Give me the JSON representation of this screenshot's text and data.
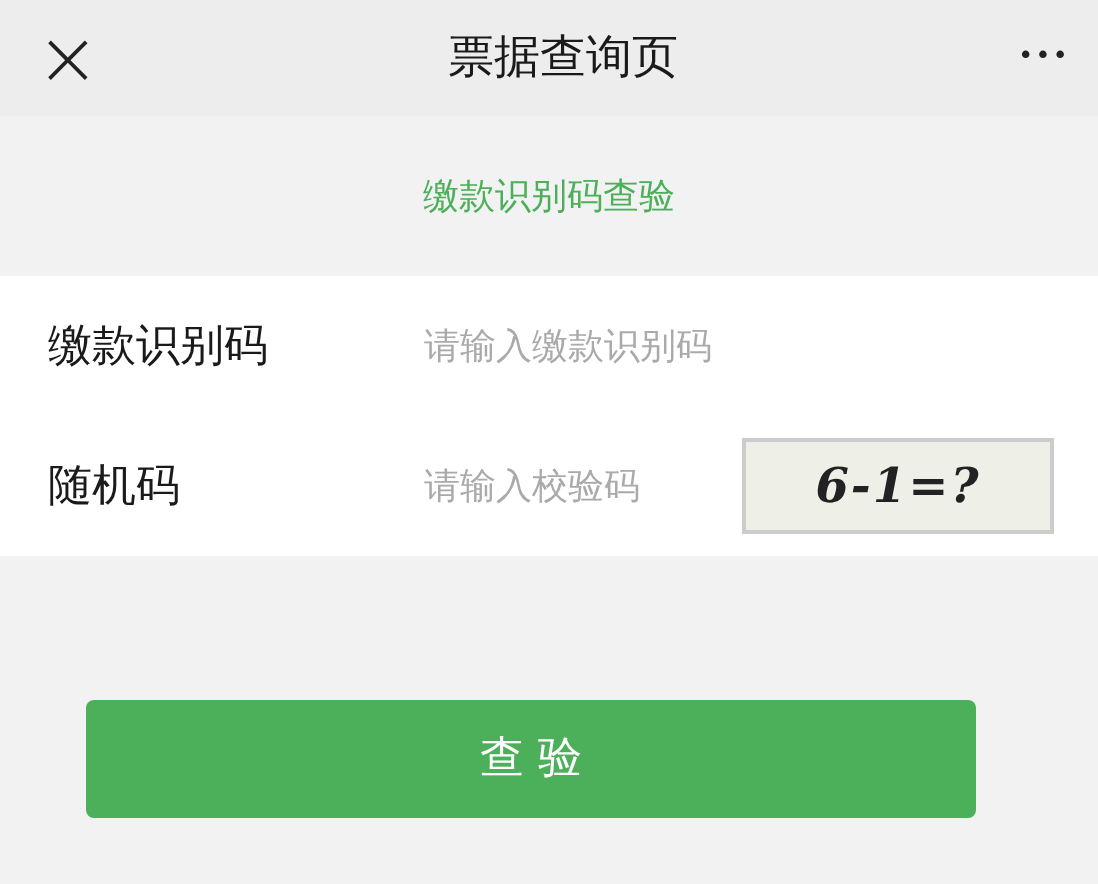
{
  "header": {
    "close": "×",
    "title": "票据查询页",
    "more": "•••"
  },
  "subtitle": "缴款识别码查验",
  "fields": [
    {
      "label": "缴款识别码",
      "placeholder": "请输入缴款识别码",
      "kind": "text"
    },
    {
      "label": "随机码",
      "placeholder": "请输入校验码",
      "kind": "captcha",
      "captcha": "6-1=?"
    }
  ],
  "submit": "查 验"
}
